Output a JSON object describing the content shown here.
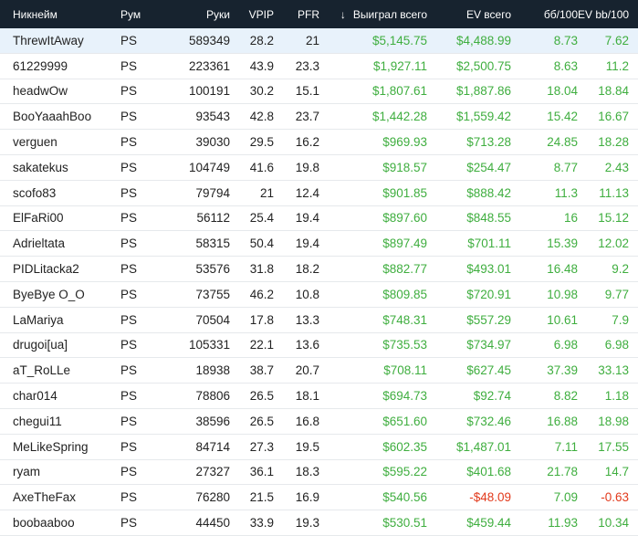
{
  "colors": {
    "header_bg": "#17232f",
    "positive": "#3fae3f",
    "negative": "#e23a1c",
    "selected_row": "#e8f2fb"
  },
  "header": {
    "nickname": "Никнейм",
    "room": "Рум",
    "hands": "Руки",
    "vpip": "VPIP",
    "pfr": "PFR",
    "sort_icon": "arrow-down-icon",
    "won": "Выиграл всего",
    "ev": "EV всего",
    "bb100": "бб/100",
    "evbb100": "EV bb/100"
  },
  "rows": [
    {
      "nick": "ThrewItAway",
      "room": "PS",
      "hands": "589349",
      "vpip": "28.2",
      "pfr": "21",
      "won": "$5,145.75",
      "ev": "$4,488.99",
      "bb": "8.73",
      "evbb": "7.62"
    },
    {
      "nick": "61229999",
      "room": "PS",
      "hands": "223361",
      "vpip": "43.9",
      "pfr": "23.3",
      "won": "$1,927.11",
      "ev": "$2,500.75",
      "bb": "8.63",
      "evbb": "11.2"
    },
    {
      "nick": "headwOw",
      "room": "PS",
      "hands": "100191",
      "vpip": "30.2",
      "pfr": "15.1",
      "won": "$1,807.61",
      "ev": "$1,887.86",
      "bb": "18.04",
      "evbb": "18.84"
    },
    {
      "nick": "BooYaaahBoo",
      "room": "PS",
      "hands": "93543",
      "vpip": "42.8",
      "pfr": "23.7",
      "won": "$1,442.28",
      "ev": "$1,559.42",
      "bb": "15.42",
      "evbb": "16.67"
    },
    {
      "nick": "verguen",
      "room": "PS",
      "hands": "39030",
      "vpip": "29.5",
      "pfr": "16.2",
      "won": "$969.93",
      "ev": "$713.28",
      "bb": "24.85",
      "evbb": "18.28"
    },
    {
      "nick": "sakatekus",
      "room": "PS",
      "hands": "104749",
      "vpip": "41.6",
      "pfr": "19.8",
      "won": "$918.57",
      "ev": "$254.47",
      "bb": "8.77",
      "evbb": "2.43"
    },
    {
      "nick": "scofo83",
      "room": "PS",
      "hands": "79794",
      "vpip": "21",
      "pfr": "12.4",
      "won": "$901.85",
      "ev": "$888.42",
      "bb": "11.3",
      "evbb": "11.13"
    },
    {
      "nick": "ElFaRi00",
      "room": "PS",
      "hands": "56112",
      "vpip": "25.4",
      "pfr": "19.4",
      "won": "$897.60",
      "ev": "$848.55",
      "bb": "16",
      "evbb": "15.12"
    },
    {
      "nick": "Adrieltata",
      "room": "PS",
      "hands": "58315",
      "vpip": "50.4",
      "pfr": "19.4",
      "won": "$897.49",
      "ev": "$701.11",
      "bb": "15.39",
      "evbb": "12.02"
    },
    {
      "nick": "PIDLitacka2",
      "room": "PS",
      "hands": "53576",
      "vpip": "31.8",
      "pfr": "18.2",
      "won": "$882.77",
      "ev": "$493.01",
      "bb": "16.48",
      "evbb": "9.2"
    },
    {
      "nick": "ByeBye O_O",
      "room": "PS",
      "hands": "73755",
      "vpip": "46.2",
      "pfr": "10.8",
      "won": "$809.85",
      "ev": "$720.91",
      "bb": "10.98",
      "evbb": "9.77"
    },
    {
      "nick": "LaMariya",
      "room": "PS",
      "hands": "70504",
      "vpip": "17.8",
      "pfr": "13.3",
      "won": "$748.31",
      "ev": "$557.29",
      "bb": "10.61",
      "evbb": "7.9"
    },
    {
      "nick": "drugoi[ua]",
      "room": "PS",
      "hands": "105331",
      "vpip": "22.1",
      "pfr": "13.6",
      "won": "$735.53",
      "ev": "$734.97",
      "bb": "6.98",
      "evbb": "6.98"
    },
    {
      "nick": "aT_RoLLe",
      "room": "PS",
      "hands": "18938",
      "vpip": "38.7",
      "pfr": "20.7",
      "won": "$708.11",
      "ev": "$627.45",
      "bb": "37.39",
      "evbb": "33.13"
    },
    {
      "nick": "char014",
      "room": "PS",
      "hands": "78806",
      "vpip": "26.5",
      "pfr": "18.1",
      "won": "$694.73",
      "ev": "$92.74",
      "bb": "8.82",
      "evbb": "1.18"
    },
    {
      "nick": "chegui11",
      "room": "PS",
      "hands": "38596",
      "vpip": "26.5",
      "pfr": "16.8",
      "won": "$651.60",
      "ev": "$732.46",
      "bb": "16.88",
      "evbb": "18.98"
    },
    {
      "nick": "MeLikeSpring",
      "room": "PS",
      "hands": "84714",
      "vpip": "27.3",
      "pfr": "19.5",
      "won": "$602.35",
      "ev": "$1,487.01",
      "bb": "7.11",
      "evbb": "17.55"
    },
    {
      "nick": "ryam",
      "room": "PS",
      "hands": "27327",
      "vpip": "36.1",
      "pfr": "18.3",
      "won": "$595.22",
      "ev": "$401.68",
      "bb": "21.78",
      "evbb": "14.7"
    },
    {
      "nick": "AxeTheFax",
      "room": "PS",
      "hands": "76280",
      "vpip": "21.5",
      "pfr": "16.9",
      "won": "$540.56",
      "ev": "-$48.09",
      "bb": "7.09",
      "evbb": "-0.63"
    },
    {
      "nick": "boobaaboo",
      "room": "PS",
      "hands": "44450",
      "vpip": "33.9",
      "pfr": "19.3",
      "won": "$530.51",
      "ev": "$459.44",
      "bb": "11.93",
      "evbb": "10.34"
    }
  ]
}
